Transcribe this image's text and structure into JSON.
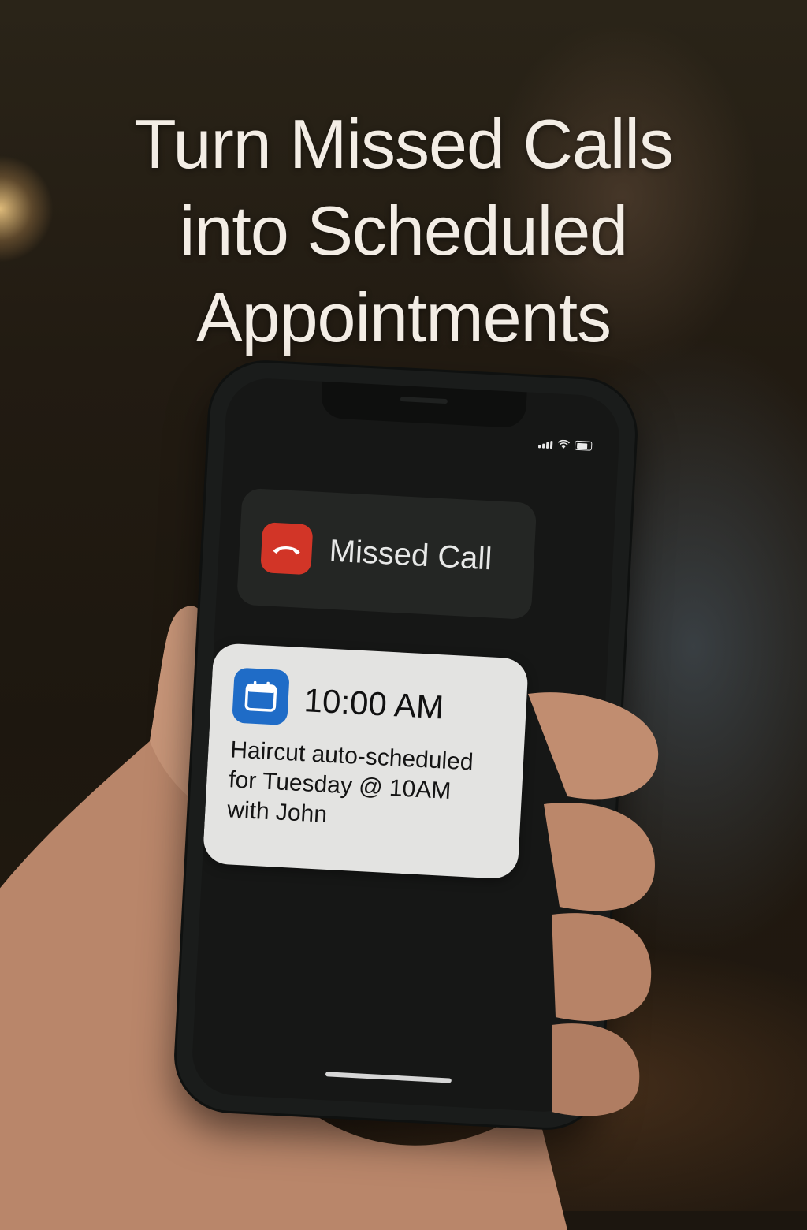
{
  "headline": {
    "line1": "Turn Missed Calls",
    "line2": "into Scheduled",
    "line3": "Appointments"
  },
  "notifications": {
    "missed_call": {
      "icon": "phone-hangup-icon",
      "icon_color": "#d23527",
      "label": "Missed Call"
    },
    "appointment": {
      "icon": "calendar-icon",
      "icon_color": "#1f6cc7",
      "time": "10:00 AM",
      "message_line1": "Haircut auto-scheduled",
      "message_line2": "for Tuesday @ 10AM",
      "message_line3": "with John"
    }
  }
}
